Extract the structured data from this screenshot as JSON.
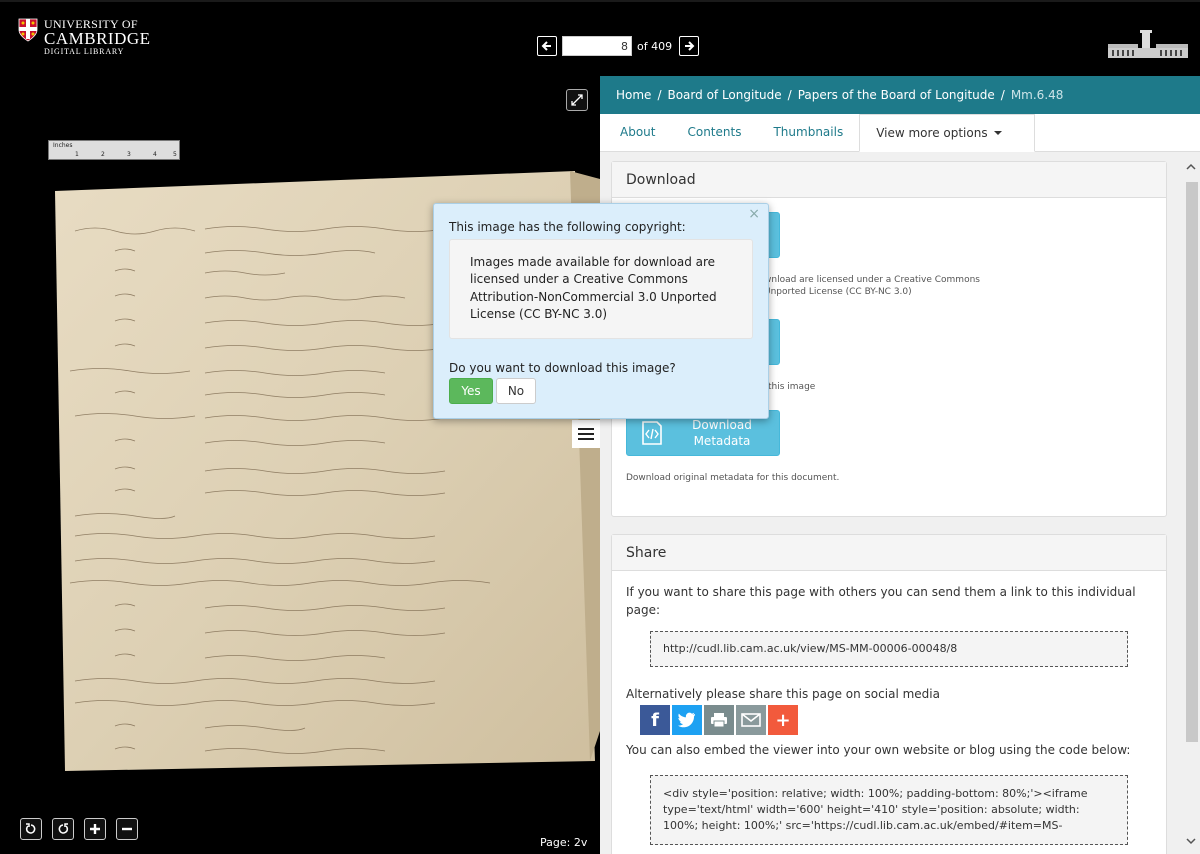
{
  "header": {
    "logo": {
      "line1": "UNIVERSITY OF",
      "line2": "CAMBRIDGE",
      "line3": "DIGITAL LIBRARY"
    },
    "pager": {
      "current_page": "8",
      "of_label": "of 409"
    }
  },
  "viewer": {
    "ruler": {
      "label": "Inches",
      "numbers": [
        "1",
        "2",
        "3",
        "4",
        "5"
      ]
    },
    "page_label": "Page: 2v",
    "tools": [
      "rotate-left-icon",
      "rotate-right-icon",
      "zoom-in-icon",
      "zoom-out-icon"
    ]
  },
  "breadcrumb": {
    "items": [
      "Home",
      "Board of Longitude",
      "Papers of the Board of Longitude"
    ],
    "current": "Mm.6.48"
  },
  "tabs": {
    "items": [
      "About",
      "Contents",
      "Thumbnails"
    ],
    "active": "View more options"
  },
  "download": {
    "heading": "Download",
    "partial_desc1_line1": "wnload are licensed under a Creative Commons",
    "partial_desc1_line2": "Unported License (CC BY-NC 3.0)",
    "partial_desc2": "this image",
    "metadata_button_line1": "Download",
    "metadata_button_line2": "Metadata",
    "metadata_desc": "Download original metadata for this document."
  },
  "share": {
    "heading": "Share",
    "intro": "If you want to share this page with others you can send them a link to this individual page:",
    "link": "http://cudl.lib.cam.ac.uk/view/MS-MM-00006-00048/8",
    "social_label": "Alternatively please share this page on social media",
    "social_icons": [
      "facebook-icon",
      "twitter-icon",
      "print-icon",
      "email-icon",
      "more-icon"
    ],
    "embed_label": "You can also embed the viewer into your own website or blog using the code below:",
    "embed_code": "<div style='position: relative; width: 100%; padding-bottom: 80%;'><iframe type='text/html' width='600' height='410' style='position: absolute; width: 100%; height: 100%;' src='https://cudl.lib.cam.ac.uk/embed/#item=MS-"
  },
  "popover": {
    "title": "This image has the following copyright:",
    "license_text": "Images made available for download are licensed under a Creative Commons Attribution-NonCommercial 3.0 Unported License (CC BY-NC 3.0)",
    "question": "Do you want to download this image?",
    "yes_label": "Yes",
    "no_label": "No",
    "close": "×"
  },
  "colors": {
    "teal": "#1e7a8a",
    "info_button": "#5bc0de",
    "success": "#5cb85c",
    "facebook": "#3b5998",
    "twitter": "#1da1f2",
    "print": "#7a8c8e",
    "email": "#8a9a9c",
    "more": "#f25a3c"
  }
}
